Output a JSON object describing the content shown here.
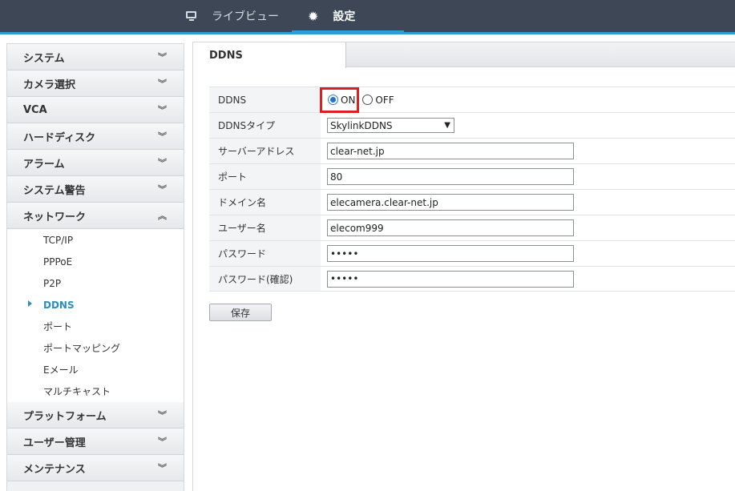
{
  "topbar": {
    "live_icon": "monitor-icon",
    "live_label": "ライブビュー",
    "settings_icon": "gear-icon",
    "settings_label": "設定"
  },
  "sidebar": {
    "sections": [
      {
        "label": "システム",
        "state": "collapsed"
      },
      {
        "label": "カメラ選択",
        "state": "collapsed"
      },
      {
        "label": "VCA",
        "state": "collapsed"
      },
      {
        "label": "ハードディスク",
        "state": "collapsed"
      },
      {
        "label": "アラーム",
        "state": "collapsed"
      },
      {
        "label": "システム警告",
        "state": "collapsed"
      },
      {
        "label": "ネットワーク",
        "state": "expanded"
      }
    ],
    "network_items": [
      {
        "label": "TCP/IP"
      },
      {
        "label": "PPPoE"
      },
      {
        "label": "P2P"
      },
      {
        "label": "DDNS",
        "active": true
      },
      {
        "label": "ポート"
      },
      {
        "label": "ポートマッピング"
      },
      {
        "label": "Eメール"
      },
      {
        "label": "マルチキャスト"
      }
    ],
    "bottom_sections": [
      {
        "label": "プラットフォーム"
      },
      {
        "label": "ユーザー管理"
      },
      {
        "label": "メンテナンス"
      }
    ],
    "chevron_down": "≫",
    "chevron_up": "≪"
  },
  "main": {
    "tab_label": "DDNS",
    "form": {
      "ddns_label": "DDNS",
      "on_label": "ON",
      "off_label": "OFF",
      "ddns_value": "ON",
      "type_label": "DDNSタイプ",
      "type_value": "SkylinkDDNS",
      "server_label": "サーバーアドレス",
      "server_value": "clear-net.jp",
      "port_label": "ポート",
      "port_value": "80",
      "domain_label": "ドメイン名",
      "domain_value": "elecamera.clear-net.jp",
      "user_label": "ユーザー名",
      "user_value": "elecom999",
      "password_label": "パスワード",
      "password_value": "•••••",
      "password_confirm_label": "パスワード(確認)",
      "password_confirm_value": "•••••"
    },
    "save_label": "保存"
  }
}
